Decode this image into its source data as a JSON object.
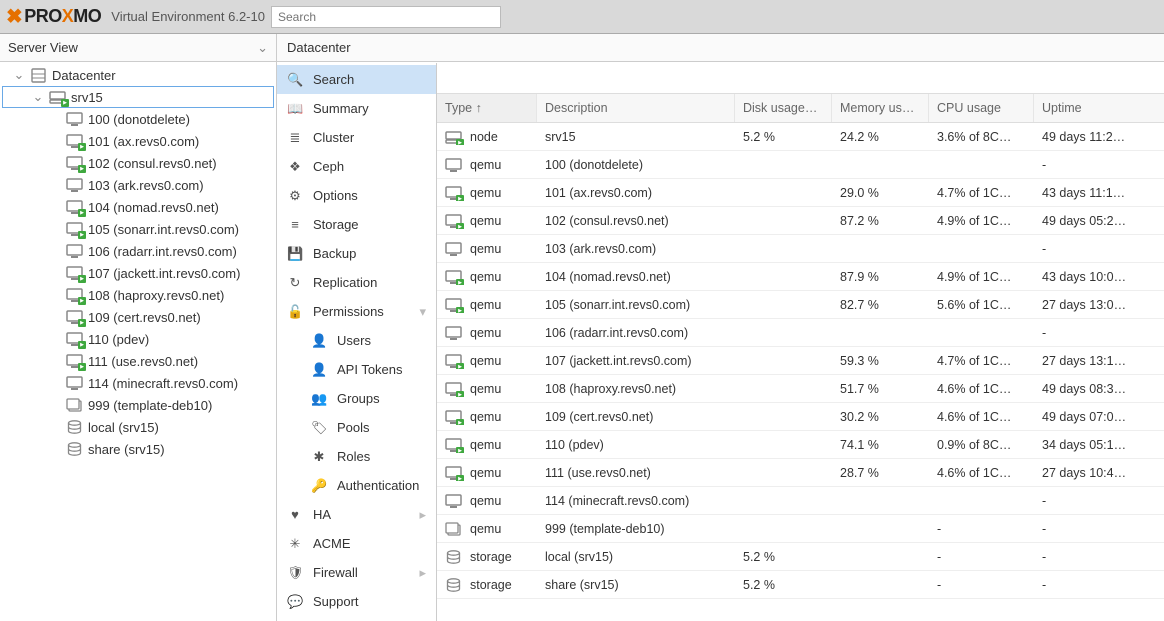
{
  "header": {
    "brand_pre": "PRO",
    "brand_x": "X",
    "brand_post": "MO",
    "subtitle": "Virtual Environment 6.2-10",
    "search_placeholder": "Search"
  },
  "left": {
    "view_label": "Server View",
    "tree": [
      {
        "depth": 0,
        "toggle": "open",
        "icon": "datacenter",
        "label": "Datacenter",
        "selected": false
      },
      {
        "depth": 1,
        "toggle": "open",
        "icon": "node",
        "label": "srv15",
        "selected": true,
        "running": true
      },
      {
        "depth": 2,
        "icon": "vm",
        "label": "100 (donotdelete)",
        "running": false
      },
      {
        "depth": 2,
        "icon": "vm",
        "label": "101 (ax.revs0.com)",
        "running": true
      },
      {
        "depth": 2,
        "icon": "vm",
        "label": "102 (consul.revs0.net)",
        "running": true
      },
      {
        "depth": 2,
        "icon": "vm",
        "label": "103 (ark.revs0.com)",
        "running": false
      },
      {
        "depth": 2,
        "icon": "vm",
        "label": "104 (nomad.revs0.net)",
        "running": true
      },
      {
        "depth": 2,
        "icon": "vm",
        "label": "105 (sonarr.int.revs0.com)",
        "running": true
      },
      {
        "depth": 2,
        "icon": "vm",
        "label": "106 (radarr.int.revs0.com)",
        "running": false
      },
      {
        "depth": 2,
        "icon": "vm",
        "label": "107 (jackett.int.revs0.com)",
        "running": true
      },
      {
        "depth": 2,
        "icon": "vm",
        "label": "108 (haproxy.revs0.net)",
        "running": true
      },
      {
        "depth": 2,
        "icon": "vm",
        "label": "109 (cert.revs0.net)",
        "running": true
      },
      {
        "depth": 2,
        "icon": "vm",
        "label": "110 (pdev)",
        "running": true
      },
      {
        "depth": 2,
        "icon": "vm",
        "label": "111 (use.revs0.net)",
        "running": true
      },
      {
        "depth": 2,
        "icon": "vm",
        "label": "114 (minecraft.revs0.com)",
        "running": false
      },
      {
        "depth": 2,
        "icon": "template",
        "label": "999 (template-deb10)",
        "running": false
      },
      {
        "depth": 2,
        "icon": "storage",
        "label": "local (srv15)",
        "running": false
      },
      {
        "depth": 2,
        "icon": "storage",
        "label": "share (srv15)",
        "running": false
      }
    ]
  },
  "crumb": "Datacenter",
  "menu": [
    {
      "icon": "search",
      "label": "Search",
      "active": true
    },
    {
      "icon": "book",
      "label": "Summary"
    },
    {
      "icon": "list",
      "label": "Cluster"
    },
    {
      "icon": "ceph",
      "label": "Ceph"
    },
    {
      "icon": "gear",
      "label": "Options"
    },
    {
      "icon": "db",
      "label": "Storage"
    },
    {
      "icon": "save",
      "label": "Backup"
    },
    {
      "icon": "repl",
      "label": "Replication"
    },
    {
      "icon": "lock",
      "label": "Permissions",
      "chev": "down"
    },
    {
      "icon": "user",
      "label": "Users",
      "sub": true
    },
    {
      "icon": "user",
      "label": "API Tokens",
      "sub": true
    },
    {
      "icon": "group",
      "label": "Groups",
      "sub": true
    },
    {
      "icon": "tag",
      "label": "Pools",
      "sub": true
    },
    {
      "icon": "role",
      "label": "Roles",
      "sub": true
    },
    {
      "icon": "key",
      "label": "Authentication",
      "sub": true
    },
    {
      "icon": "heart",
      "label": "HA",
      "chev": "right"
    },
    {
      "icon": "acme",
      "label": "ACME"
    },
    {
      "icon": "shield",
      "label": "Firewall",
      "chev": "right"
    },
    {
      "icon": "chat",
      "label": "Support"
    }
  ],
  "grid": {
    "headers": {
      "type": "Type ↑",
      "desc": "Description",
      "disk": "Disk usage…",
      "mem": "Memory us…",
      "cpu": "CPU usage",
      "up": "Uptime"
    },
    "rows": [
      {
        "icon": "node",
        "running": true,
        "type": "node",
        "desc": "srv15",
        "disk": "5.2 %",
        "mem": "24.2 %",
        "cpu": "3.6% of 8C…",
        "up": "49 days 11:2…"
      },
      {
        "icon": "vm",
        "running": false,
        "type": "qemu",
        "desc": "100 (donotdelete)",
        "disk": "",
        "mem": "",
        "cpu": "",
        "up": "-"
      },
      {
        "icon": "vm",
        "running": true,
        "type": "qemu",
        "desc": "101 (ax.revs0.com)",
        "disk": "",
        "mem": "29.0 %",
        "cpu": "4.7% of 1C…",
        "up": "43 days 11:1…"
      },
      {
        "icon": "vm",
        "running": true,
        "type": "qemu",
        "desc": "102 (consul.revs0.net)",
        "disk": "",
        "mem": "87.2 %",
        "cpu": "4.9% of 1C…",
        "up": "49 days 05:2…"
      },
      {
        "icon": "vm",
        "running": false,
        "type": "qemu",
        "desc": "103 (ark.revs0.com)",
        "disk": "",
        "mem": "",
        "cpu": "",
        "up": "-"
      },
      {
        "icon": "vm",
        "running": true,
        "type": "qemu",
        "desc": "104 (nomad.revs0.net)",
        "disk": "",
        "mem": "87.9 %",
        "cpu": "4.9% of 1C…",
        "up": "43 days 10:0…"
      },
      {
        "icon": "vm",
        "running": true,
        "type": "qemu",
        "desc": "105 (sonarr.int.revs0.com)",
        "disk": "",
        "mem": "82.7 %",
        "cpu": "5.6% of 1C…",
        "up": "27 days 13:0…"
      },
      {
        "icon": "vm",
        "running": false,
        "type": "qemu",
        "desc": "106 (radarr.int.revs0.com)",
        "disk": "",
        "mem": "",
        "cpu": "",
        "up": "-"
      },
      {
        "icon": "vm",
        "running": true,
        "type": "qemu",
        "desc": "107 (jackett.int.revs0.com)",
        "disk": "",
        "mem": "59.3 %",
        "cpu": "4.7% of 1C…",
        "up": "27 days 13:1…"
      },
      {
        "icon": "vm",
        "running": true,
        "type": "qemu",
        "desc": "108 (haproxy.revs0.net)",
        "disk": "",
        "mem": "51.7 %",
        "cpu": "4.6% of 1C…",
        "up": "49 days 08:3…"
      },
      {
        "icon": "vm",
        "running": true,
        "type": "qemu",
        "desc": "109 (cert.revs0.net)",
        "disk": "",
        "mem": "30.2 %",
        "cpu": "4.6% of 1C…",
        "up": "49 days 07:0…"
      },
      {
        "icon": "vm",
        "running": true,
        "type": "qemu",
        "desc": "110 (pdev)",
        "disk": "",
        "mem": "74.1 %",
        "cpu": "0.9% of 8C…",
        "up": "34 days 05:1…"
      },
      {
        "icon": "vm",
        "running": true,
        "type": "qemu",
        "desc": "111 (use.revs0.net)",
        "disk": "",
        "mem": "28.7 %",
        "cpu": "4.6% of 1C…",
        "up": "27 days 10:4…"
      },
      {
        "icon": "vm",
        "running": false,
        "type": "qemu",
        "desc": "114 (minecraft.revs0.com)",
        "disk": "",
        "mem": "",
        "cpu": "",
        "up": "-"
      },
      {
        "icon": "template",
        "running": false,
        "type": "qemu",
        "desc": "999 (template-deb10)",
        "disk": "",
        "mem": "",
        "cpu": "-",
        "up": "-"
      },
      {
        "icon": "storage",
        "running": false,
        "type": "storage",
        "desc": "local (srv15)",
        "disk": "5.2 %",
        "mem": "",
        "cpu": "-",
        "up": "-"
      },
      {
        "icon": "storage",
        "running": false,
        "type": "storage",
        "desc": "share (srv15)",
        "disk": "5.2 %",
        "mem": "",
        "cpu": "-",
        "up": "-"
      }
    ]
  }
}
